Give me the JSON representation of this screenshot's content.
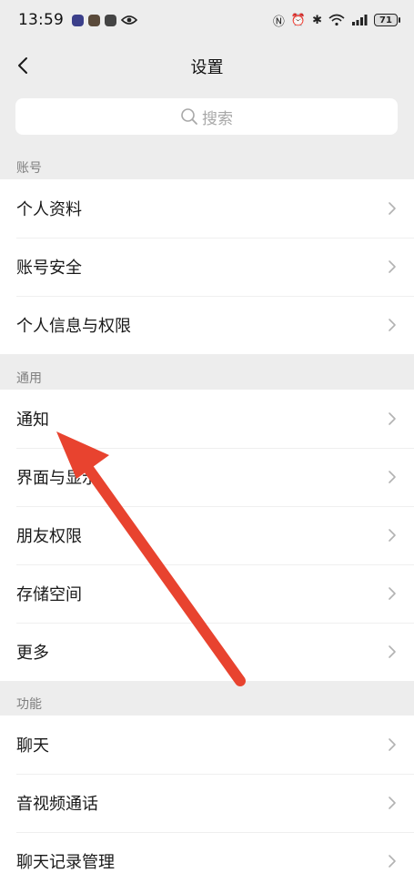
{
  "status_bar": {
    "time": "13:59",
    "battery": "71"
  },
  "nav": {
    "title": "设置"
  },
  "search": {
    "placeholder": "搜索"
  },
  "sections": [
    {
      "header": "账号",
      "items": [
        {
          "label": "个人资料"
        },
        {
          "label": "账号安全"
        },
        {
          "label": "个人信息与权限"
        }
      ]
    },
    {
      "header": "通用",
      "items": [
        {
          "label": "通知"
        },
        {
          "label": "界面与显示"
        },
        {
          "label": "朋友权限"
        },
        {
          "label": "存储空间"
        },
        {
          "label": "更多"
        }
      ]
    },
    {
      "header": "功能",
      "items": [
        {
          "label": "聊天"
        },
        {
          "label": "音视频通话"
        },
        {
          "label": "聊天记录管理"
        }
      ]
    }
  ],
  "colors": {
    "background": "#ededed",
    "annotation_arrow": "#e8432f"
  }
}
